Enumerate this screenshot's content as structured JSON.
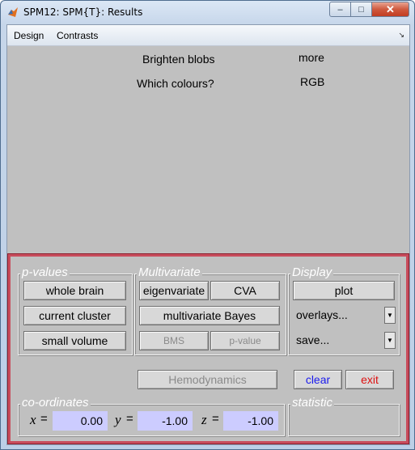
{
  "window": {
    "title": "SPM12: SPM{T}: Results"
  },
  "window_controls": {
    "minimize": "–",
    "maximize": "□",
    "close": "✕"
  },
  "menubar": {
    "items": [
      "Design",
      "Contrasts"
    ],
    "corner_glyph": "↘"
  },
  "options": {
    "brighten_label": "Brighten blobs",
    "brighten_value": "more",
    "colours_label": "Which colours?",
    "colours_value": "RGB"
  },
  "pvalues": {
    "title": "p-values",
    "whole_brain": "whole brain",
    "current_cluster": "current cluster",
    "small_volume": "small volume"
  },
  "multivariate": {
    "title": "Multivariate",
    "eigenvariate": "eigenvariate",
    "cva": "CVA",
    "bayes": "multivariate Bayes",
    "bms": "BMS",
    "pvalue": "p-value"
  },
  "display": {
    "title": "Display",
    "plot": "plot",
    "overlays": "overlays...",
    "save": "save..."
  },
  "actions": {
    "hemodynamics": "Hemodynamics",
    "clear": "clear",
    "exit": "exit"
  },
  "coordinates": {
    "title": "co-ordinates",
    "x_label": "x",
    "y_label": "y",
    "z_label": "z",
    "eq": "=",
    "x": "0.00",
    "y": "-1.00",
    "z": "-1.00"
  },
  "statistic": {
    "title": "statistic"
  },
  "colors": {
    "panel_border": "#c84c5c",
    "coord_bg": "#ccccff",
    "clear_text": "#1a1aee",
    "exit_text": "#dd1111"
  },
  "icons": {
    "app": "matlab-logo-icon",
    "dropdown": "dropdown-arrow-icon"
  }
}
